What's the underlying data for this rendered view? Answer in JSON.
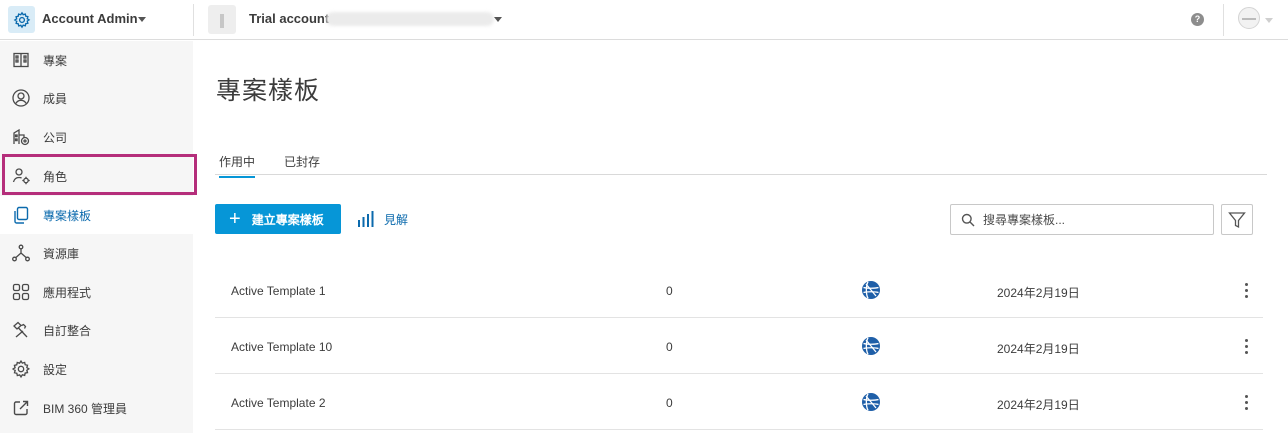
{
  "topbar": {
    "app_icon": "gear-icon",
    "app_title": "Account Admin",
    "account_label": "Trial account",
    "help_icon": "help-icon",
    "help_glyph": "?"
  },
  "sidebar": {
    "items": [
      {
        "label": "專案",
        "icon": "building-icon",
        "active": false
      },
      {
        "label": "成員",
        "icon": "user-circle-icon",
        "active": false
      },
      {
        "label": "公司",
        "icon": "company-icon",
        "active": false
      },
      {
        "label": "角色",
        "icon": "user-gear-icon",
        "active": false
      },
      {
        "label": "專案樣板",
        "icon": "copy-icon",
        "active": true
      },
      {
        "label": "資源庫",
        "icon": "network-icon",
        "active": false
      },
      {
        "label": "應用程式",
        "icon": "apps-grid-icon",
        "active": false
      },
      {
        "label": "自訂整合",
        "icon": "hammer-icon",
        "active": false
      },
      {
        "label": "設定",
        "icon": "gear-icon",
        "active": false
      },
      {
        "label": "BIM 360 管理員",
        "icon": "external-link-icon",
        "active": false
      }
    ]
  },
  "main": {
    "page_title": "專案樣板",
    "tabs": [
      {
        "label": "作用中",
        "active": true
      },
      {
        "label": "已封存",
        "active": false
      }
    ],
    "create_button": {
      "plus": "+",
      "label": "建立專案樣板"
    },
    "insight_label": "見解",
    "search": {
      "placeholder": "搜尋專案樣板..."
    },
    "templates": [
      {
        "name": "Active Template 1",
        "count": "0",
        "date": "2024年2月19日",
        "icon": "globe-icon"
      },
      {
        "name": "Active Template 10",
        "count": "0",
        "date": "2024年2月19日",
        "icon": "globe-icon"
      },
      {
        "name": "Active Template 2",
        "count": "0",
        "date": "2024年2月19日",
        "icon": "globe-icon"
      }
    ]
  },
  "colors": {
    "accent": "#0696d7",
    "link": "#0b6aad",
    "highlight": "#b52e7b",
    "sidebar_bg": "#f6f6f6"
  }
}
